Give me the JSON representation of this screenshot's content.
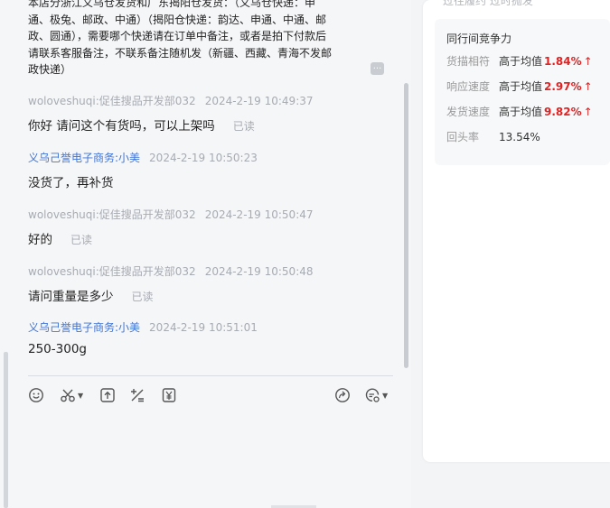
{
  "notice": {
    "text": "本店分浙江义乌仓发货和广东揭阳仓发货：（义乌仓快递：申通、极兔、邮政、中通）（揭阳仓快递：韵达、申通、中通、邮政、圆通），需要哪个快递请在订单中备注，或者是拍下付款后请联系客服备注，不联系备注随机发（新疆、西藏、青海不发邮政快递）",
    "more_label": "..."
  },
  "messages": [
    {
      "sender": "woloveshuqi:促佳搜品开发部032",
      "time": "2024-2-19 10:49:37",
      "text": "你好 请问这个有货吗，可以上架吗",
      "read": "已读",
      "side": "buyer"
    },
    {
      "sender": "义乌己誉电子商务:小美",
      "time": "2024-2-19 10:50:23",
      "text": "没货了，再补货",
      "read": "",
      "side": "seller"
    },
    {
      "sender": "woloveshuqi:促佳搜品开发部032",
      "time": "2024-2-19 10:50:47",
      "text": "好的",
      "read": "已读",
      "side": "buyer"
    },
    {
      "sender": "woloveshuqi:促佳搜品开发部032",
      "time": "2024-2-19 10:50:48",
      "text": "请问重量是多少",
      "read": "已读",
      "side": "buyer"
    },
    {
      "sender": "义乌己誉电子商务:小美",
      "time": "2024-2-19 10:51:01",
      "text": "250-300g",
      "read": "",
      "side": "seller"
    }
  ],
  "toolbar": {
    "icons": [
      "emoji-icon",
      "scissors-icon",
      "upload-icon",
      "calculator-icon",
      "yen-icon",
      "share-icon",
      "quick-reply-icon"
    ]
  },
  "right_panel": {
    "top_text": "过往履约  过时抛发",
    "card": {
      "title": "同行间竞争力",
      "rows": [
        {
          "label": "货描相符",
          "value": "高于均值",
          "pct": "1.84%",
          "arrow": "↑"
        },
        {
          "label": "响应速度",
          "value": "高于均值",
          "pct": "2.97%",
          "arrow": "↑"
        },
        {
          "label": "发货速度",
          "value": "高于均值",
          "pct": "9.82%",
          "arrow": "↑"
        },
        {
          "label": "回头率",
          "value": "13.54%",
          "pct": "",
          "arrow": ""
        }
      ]
    }
  },
  "colors": {
    "seller_name": "#3f74d6",
    "meta_gray": "#a7abb2",
    "up_red": "#e02424"
  }
}
